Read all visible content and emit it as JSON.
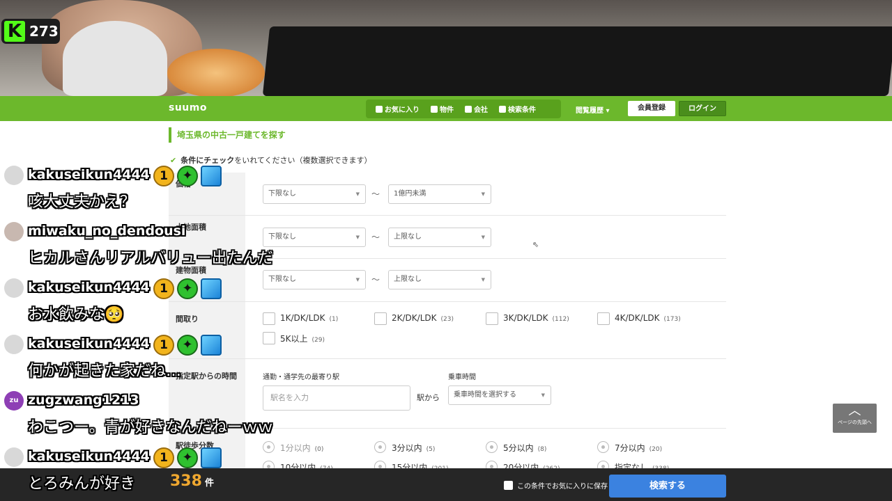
{
  "stream": {
    "viewer_count": "273",
    "platform_logo": "K"
  },
  "header": {
    "logo": "suumo",
    "nav": [
      {
        "label": "お気に入り",
        "icon": "check-box-icon"
      },
      {
        "label": "物件",
        "icon": "home-icon"
      },
      {
        "label": "会社",
        "icon": "building-icon"
      },
      {
        "label": "検索条件",
        "icon": "search-icon"
      }
    ],
    "history": "閲覧履歴 ▾",
    "register": "会員登録",
    "login": "ログイン"
  },
  "page": {
    "title": "埼玉県の中古一戸建てを探す",
    "instruction_bold": "条件にチェック",
    "instruction_rest": "をいれてください（複数選択できます）"
  },
  "form": {
    "price": {
      "label": "価格",
      "min": "下限なし",
      "max": "1億円未満",
      "sep": "〜"
    },
    "land": {
      "label": "土地面積",
      "min": "下限なし",
      "max": "上限なし",
      "sep": "〜"
    },
    "building": {
      "label": "建物面積",
      "min": "下限なし",
      "max": "上限なし",
      "sep": "〜"
    },
    "layout": {
      "label": "間取り",
      "options": [
        {
          "label": "1K/DK/LDK",
          "count": "(1)"
        },
        {
          "label": "2K/DK/LDK",
          "count": "(23)"
        },
        {
          "label": "3K/DK/LDK",
          "count": "(112)"
        },
        {
          "label": "4K/DK/LDK",
          "count": "(173)"
        },
        {
          "label": "5K以上",
          "count": "(29)"
        }
      ]
    },
    "commute": {
      "label": "指定駅からの時間",
      "station_label": "通勤・通学先の最寄り駅",
      "station_placeholder": "駅名を入力",
      "from": "駅から",
      "time_label": "乗車時間",
      "time_select": "乗車時間を選択する"
    },
    "walk": {
      "label": "駅徒歩分数",
      "options": [
        {
          "label": "1分以内",
          "count": "(0)"
        },
        {
          "label": "3分以内",
          "count": "(5)"
        },
        {
          "label": "5分以内",
          "count": "(8)"
        },
        {
          "label": "7分以内",
          "count": "(20)"
        },
        {
          "label": "10分以内",
          "count": "(74)"
        },
        {
          "label": "15分以内",
          "count": "(201)"
        },
        {
          "label": "20分以内",
          "count": "(262)"
        },
        {
          "label": "指定なし",
          "count": "(338)"
        }
      ]
    }
  },
  "footer": {
    "total": "338",
    "unit": "件",
    "save_label": "この条件でお気に入りに保存",
    "search_button": "検索する",
    "page_top": "ページの先頭へ"
  },
  "chat": [
    {
      "user": "kakuseikun4444",
      "text": "咳大丈夫かえ？",
      "badges": true,
      "avatar_color": "#d8d8d8"
    },
    {
      "user": "miwaku_no_dendousi",
      "text": "ヒカルさんリアルバリュー出たんだ",
      "badges": false,
      "avatar_color": "#c8b8b0"
    },
    {
      "user": "kakuseikun4444",
      "text": "お水飲みな🥺",
      "badges": true,
      "avatar_color": "#d8d8d8"
    },
    {
      "user": "kakuseikun4444",
      "text": "何かが起きた家だね…",
      "badges": true,
      "avatar_color": "#d8d8d8"
    },
    {
      "user": "zugzwang1213",
      "text": "わこつー。青が好きなんだねーｗｗ",
      "badges": false,
      "avatar_color": "#8e3fb5",
      "avatar_text": "zu"
    },
    {
      "user": "kakuseikun4444",
      "text": "とろみんが好き",
      "badges": true,
      "avatar_color": "#d8d8d8"
    }
  ],
  "badge_digit": "1"
}
